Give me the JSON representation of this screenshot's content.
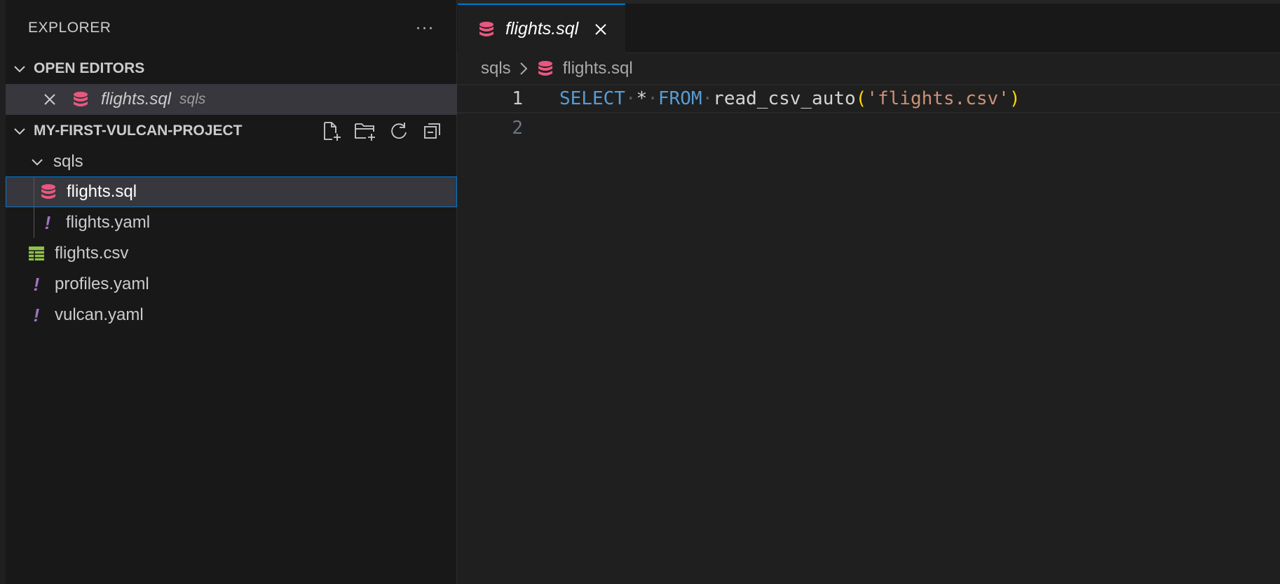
{
  "explorer": {
    "title": "EXPLORER",
    "more_label": "···"
  },
  "open_editors": {
    "header": "OPEN EDITORS",
    "items": [
      {
        "filename": "flights.sql",
        "folder": "sqls",
        "icon": "database-icon"
      }
    ]
  },
  "project": {
    "header": "MY-FIRST-VULCAN-PROJECT",
    "tree": [
      {
        "label": "sqls",
        "type": "folder",
        "expanded": true
      },
      {
        "label": "flights.sql",
        "type": "sql",
        "icon": "database-icon",
        "selected": true
      },
      {
        "label": "flights.yaml",
        "type": "yaml",
        "icon": "yaml-icon"
      },
      {
        "label": "flights.csv",
        "type": "csv",
        "icon": "table-icon"
      },
      {
        "label": "profiles.yaml",
        "type": "yaml",
        "icon": "yaml-icon"
      },
      {
        "label": "vulcan.yaml",
        "type": "yaml",
        "icon": "yaml-icon"
      }
    ]
  },
  "tab": {
    "label": "flights.sql"
  },
  "breadcrumb": {
    "folder": "sqls",
    "file": "flights.sql"
  },
  "editor": {
    "line_numbers": [
      "1",
      "2"
    ],
    "tokens": {
      "select": "SELECT",
      "star": "*",
      "from": "FROM",
      "fn": "read_csv_auto",
      "open": "(",
      "str": "'flights.csv'",
      "close": ")"
    }
  },
  "colors": {
    "accent": "#0078d4",
    "sql_icon": "#e8577f",
    "yaml_icon": "#a074c4",
    "csv_icon": "#8dc149"
  }
}
